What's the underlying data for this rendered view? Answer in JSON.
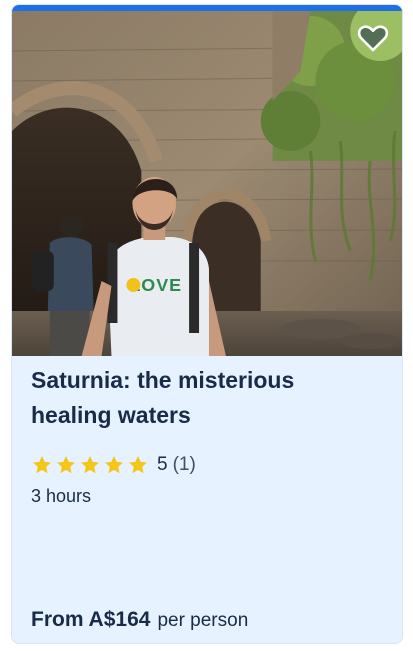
{
  "card": {
    "title": "Saturnia: the misterious healing waters",
    "rating": {
      "value": "5",
      "count": "(1)",
      "stars": 5,
      "star_color": "#f5c518"
    },
    "duration": "3 hours",
    "price": {
      "amount": "From A$164",
      "unit": "per person"
    },
    "wishlist_icon": "heart-outline-icon",
    "accent_color": "#1f6fe5",
    "background_color": "#e6f2ff"
  },
  "photo": {
    "shirt_text": "LOVE"
  }
}
